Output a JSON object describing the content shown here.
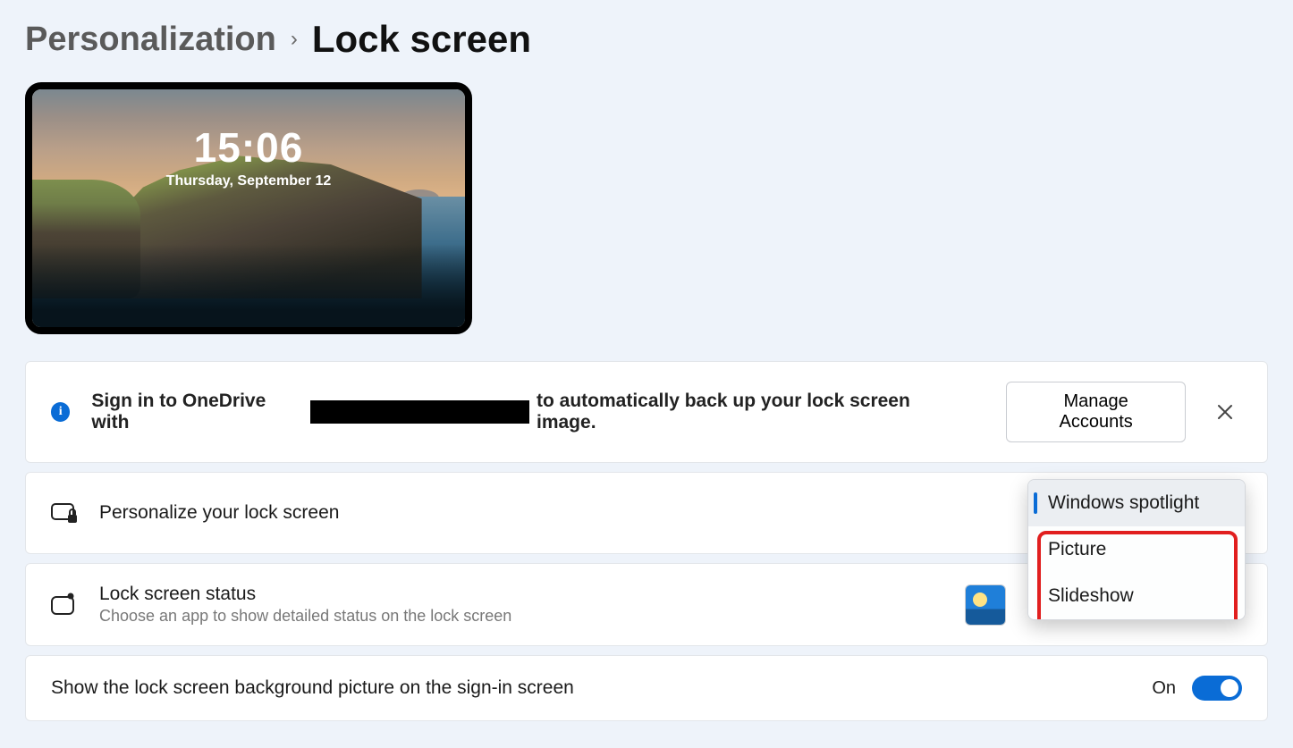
{
  "breadcrumb": {
    "parent": "Personalization",
    "current": "Lock screen"
  },
  "preview": {
    "time": "15:06",
    "date": "Thursday, September 12"
  },
  "banner": {
    "text_before": "Sign in to OneDrive with",
    "text_after": "to automatically back up your lock screen image.",
    "button": "Manage Accounts"
  },
  "settings": {
    "personalize": {
      "title": "Personalize your lock screen",
      "options": {
        "spotlight": "Windows spotlight",
        "picture": "Picture",
        "slideshow": "Slideshow"
      }
    },
    "status": {
      "title": "Lock screen status",
      "subtitle": "Choose an app to show detailed status on the lock screen"
    },
    "signin_bg": {
      "title": "Show the lock screen background picture on the sign-in screen",
      "state": "On"
    }
  }
}
